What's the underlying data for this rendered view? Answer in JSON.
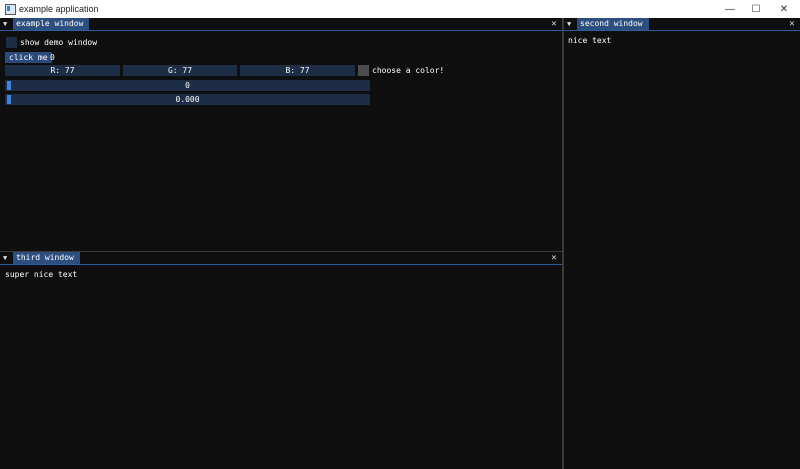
{
  "window": {
    "title": "example application",
    "minimize_glyph": "—",
    "maximize_glyph": "☐",
    "close_glyph": "✕"
  },
  "example_window": {
    "tab_label": "example window",
    "show_demo_label": "show demo window",
    "click_button_label": "click me",
    "click_count": "0",
    "color_r": "R: 77",
    "color_g": "G: 77",
    "color_b": "B: 77",
    "color_label": "choose a color!",
    "swatch_color": "#4d4d4d",
    "int_slider_value": "0",
    "float_slider_value": "0.000"
  },
  "second_window": {
    "tab_label": "second window",
    "text": "nice text"
  },
  "third_window": {
    "tab_label": "third window",
    "text": "super nice text"
  },
  "icons": {
    "menu": "▼",
    "close": "✕"
  },
  "colors": {
    "background": "#0f0f0f",
    "tab_active": "#2d4f80",
    "frame_bg": "#1d2d45",
    "slider_grab": "#3d85e0"
  }
}
